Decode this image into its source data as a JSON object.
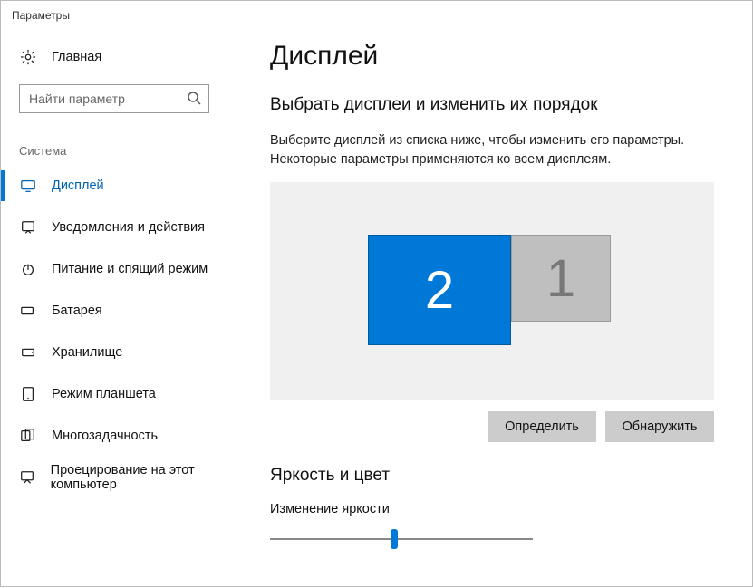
{
  "window": {
    "title": "Параметры"
  },
  "sidebar": {
    "home": "Главная",
    "search_placeholder": "Найти параметр",
    "section": "Система",
    "items": [
      {
        "label": "Дисплей",
        "selected": true
      },
      {
        "label": "Уведомления и действия"
      },
      {
        "label": "Питание и спящий режим"
      },
      {
        "label": "Батарея"
      },
      {
        "label": "Хранилище"
      },
      {
        "label": "Режим планшета"
      },
      {
        "label": "Многозадачность"
      },
      {
        "label": "Проецирование на этот компьютер"
      }
    ]
  },
  "content": {
    "heading": "Дисплей",
    "arrange_heading": "Выбрать дисплеи и изменить их порядок",
    "arrange_desc": "Выберите дисплей из списка ниже, чтобы изменить его параметры. Некоторые параметры применяются ко всем дисплеям.",
    "monitors": {
      "primary": "2",
      "secondary": "1"
    },
    "buttons": {
      "identify": "Определить",
      "detect": "Обнаружить"
    },
    "brightness_heading": "Яркость и цвет",
    "brightness_label": "Изменение яркости",
    "brightness_value_pct": 47
  }
}
